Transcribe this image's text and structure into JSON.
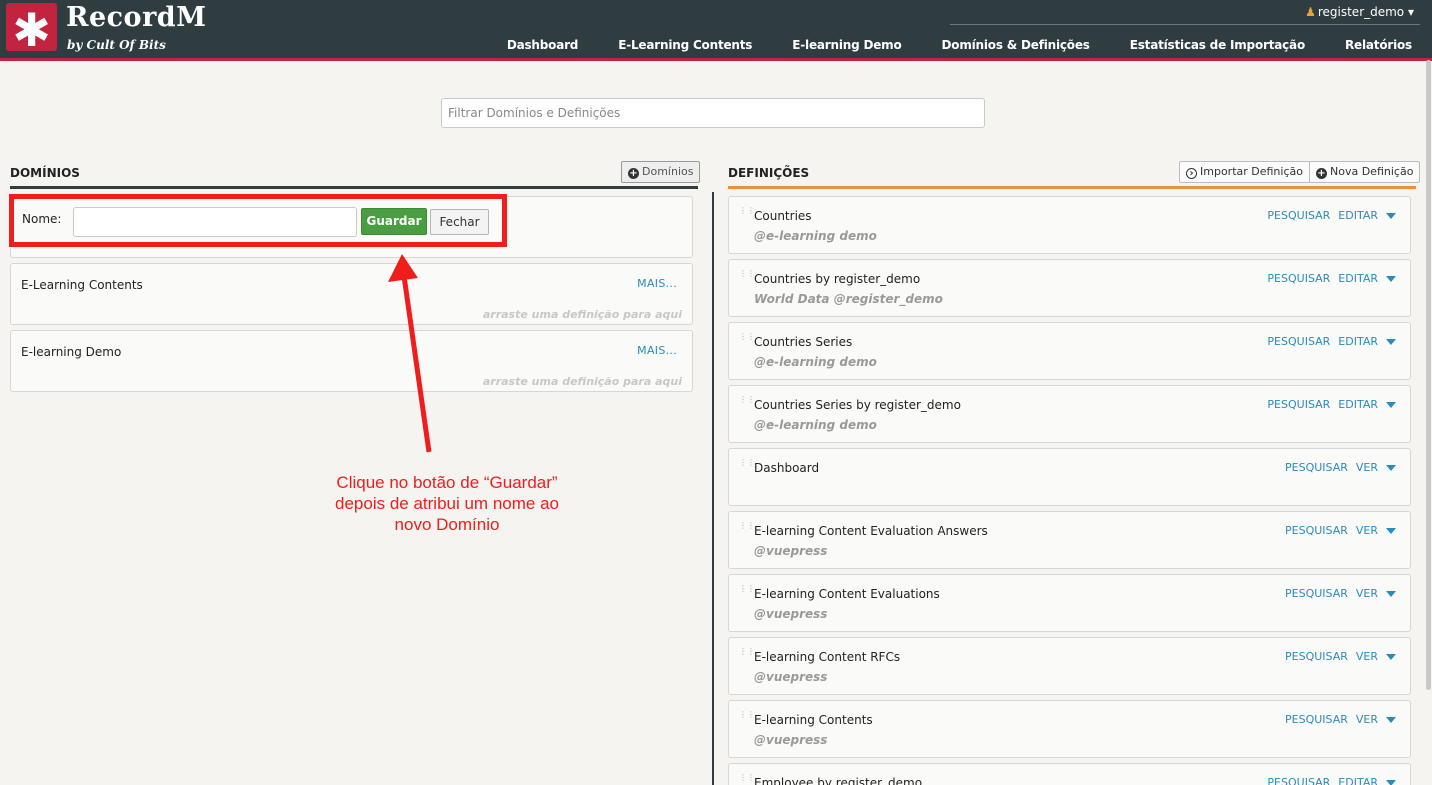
{
  "header": {
    "logo_symbol": "✱",
    "logo_title": "RecordM",
    "logo_subtitle": "by Cult Of Bits",
    "user": "register_demo",
    "nav": [
      "Dashboard",
      "E-Learning Contents",
      "E-learning Demo",
      "Domínios & Definições",
      "Estatísticas de Importação",
      "Relatórios"
    ]
  },
  "filter": {
    "placeholder": "Filtrar Domínios e Definições",
    "value": ""
  },
  "domains": {
    "title": "DOMÍNIOS",
    "button": "Domínios",
    "new_form": {
      "label": "Nome:",
      "value": "",
      "save": "Guardar",
      "close": "Fechar"
    },
    "items": [
      {
        "name": "E-Learning Contents",
        "more": "MAIS...",
        "hint": "arraste uma definição para aqui"
      },
      {
        "name": "E-learning Demo",
        "more": "MAIS...",
        "hint": "arraste uma definição para aqui"
      }
    ]
  },
  "annotation": {
    "line1": "Clique no botão de “Guardar”",
    "line2": "depois de atribui um nome ao",
    "line3": "novo Domínio",
    "color": "#f01d1d"
  },
  "definitions": {
    "title": "DEFINIÇÕES",
    "import_button": "Importar Definição",
    "new_button": "Nova Definição",
    "items": [
      {
        "name": "Countries",
        "sub": "@e-learning demo",
        "search": "PESQUISAR",
        "action": "EDITAR"
      },
      {
        "name": "Countries by register_demo",
        "sub": "World Data @register_demo",
        "search": "PESQUISAR",
        "action": "EDITAR"
      },
      {
        "name": "Countries Series",
        "sub": "@e-learning demo",
        "search": "PESQUISAR",
        "action": "EDITAR"
      },
      {
        "name": "Countries Series by register_demo",
        "sub": "@e-learning demo",
        "search": "PESQUISAR",
        "action": "EDITAR"
      },
      {
        "name": "Dashboard",
        "sub": "",
        "search": "PESQUISAR",
        "action": "VER"
      },
      {
        "name": "E-learning Content Evaluation Answers",
        "sub": "@vuepress",
        "search": "PESQUISAR",
        "action": "VER"
      },
      {
        "name": "E-learning Content Evaluations",
        "sub": "@vuepress",
        "search": "PESQUISAR",
        "action": "VER"
      },
      {
        "name": "E-learning Content RFCs",
        "sub": "@vuepress",
        "search": "PESQUISAR",
        "action": "VER"
      },
      {
        "name": "E-learning Contents",
        "sub": "@vuepress",
        "search": "PESQUISAR",
        "action": "VER"
      },
      {
        "name": "Employee by register_demo",
        "sub": "",
        "search": "PESQUISAR",
        "action": "EDITAR"
      }
    ]
  },
  "colors": {
    "header": "#2f3d40",
    "brand": "#c4233f",
    "link": "#2a8bbd",
    "save": "#4a9e41",
    "definitions_accent": "#e8923c"
  }
}
